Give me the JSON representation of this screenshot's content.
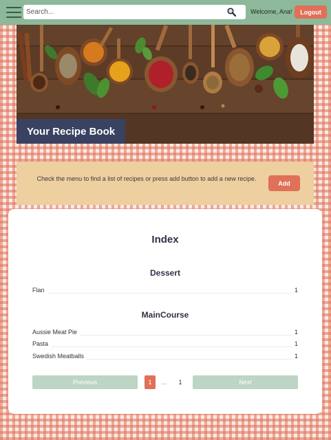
{
  "header": {
    "search_placeholder": "Search...",
    "search_value": "",
    "welcome_text": "Welcome, Ana!",
    "logout_label": "Logout",
    "icons": {
      "menu": "hamburger-menu-icon",
      "search": "magnifier-icon"
    }
  },
  "hero": {
    "title": "Your Recipe Book"
  },
  "notice": {
    "text": "Check the menu to find a list of recipes or press add button to add a new recipe.",
    "add_label": "Add"
  },
  "index": {
    "title": "Index",
    "categories": [
      {
        "name": "Dessert",
        "recipes": [
          {
            "name": "Flan",
            "page": "1"
          }
        ]
      },
      {
        "name": "MainCourse",
        "recipes": [
          {
            "name": "Aussie Meat Pie",
            "page": "1"
          },
          {
            "name": "Pasta",
            "page": "1"
          },
          {
            "name": "Swedish Meatballs",
            "page": "1"
          }
        ]
      }
    ]
  },
  "pagination": {
    "previous_label": "Previous",
    "current_page": "1",
    "ellipsis": "...",
    "last_page": "1",
    "next_label": "Next"
  },
  "colors": {
    "header_bg": "#8db89a",
    "accent": "#e07058",
    "title_bar_bg": "#3a4262",
    "notice_bg": "#edcfa0",
    "pagination_button_bg": "#bcd5c4"
  }
}
